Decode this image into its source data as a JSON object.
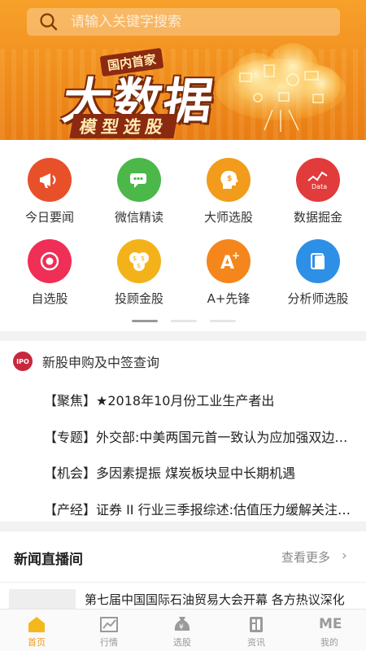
{
  "search": {
    "placeholder": "请输入关键字搜索"
  },
  "banner": {
    "tag": "国内首家",
    "title": "大数据",
    "subtitle": "模型选股"
  },
  "features": [
    {
      "label": "今日要闻",
      "icon": "megaphone-icon",
      "color": "#e8502a"
    },
    {
      "label": "微信精读",
      "icon": "chat-icon",
      "color": "#4cb84a"
    },
    {
      "label": "大师选股",
      "icon": "head-icon",
      "color": "#f39b1a"
    },
    {
      "label": "数据掘金",
      "icon": "data-chart-icon",
      "color": "#e23b3b"
    },
    {
      "label": "自选股",
      "icon": "eye-icon",
      "color": "#ef2f55"
    },
    {
      "label": "投顾金股",
      "icon": "coins-icon",
      "color": "#f3b21a"
    },
    {
      "label": "A+先锋",
      "icon": "a-plus-icon",
      "color": "#f5861c"
    },
    {
      "label": "分析师选股",
      "icon": "notebook-icon",
      "color": "#2e8fe6"
    }
  ],
  "ipo": {
    "badge": "IPO",
    "title": "新股申购及中签查询",
    "items": [
      "【聚焦】★2018年10月份工业生产者出",
      "【专题】外交部:中美两国元首一致认为应加强双边关系的讨论",
      "【机会】多因素提振 煤炭板块显中长期机遇",
      "【产经】证券 II 行业三季报综述:估值压力缓解关注市场变化"
    ]
  },
  "live": {
    "title": "新闻直播间",
    "more": "查看更多",
    "arrow": "›",
    "headline": "第七届中国国际石油贸易大会开幕 各方热议深化"
  },
  "tabs": [
    {
      "label": "首页",
      "icon": "home-icon",
      "active": true
    },
    {
      "label": "行情",
      "icon": "trend-icon",
      "active": false
    },
    {
      "label": "选股",
      "icon": "yen-bag-icon",
      "active": false
    },
    {
      "label": "资讯",
      "icon": "news-icon",
      "active": false
    },
    {
      "label": "我的",
      "icon": "me-icon",
      "active": false
    },
    {
      "label": "ME",
      "icon": "me-icon",
      "active": false
    }
  ],
  "colors": {
    "accent": "#f29a16",
    "banner": "#f08d1c"
  }
}
